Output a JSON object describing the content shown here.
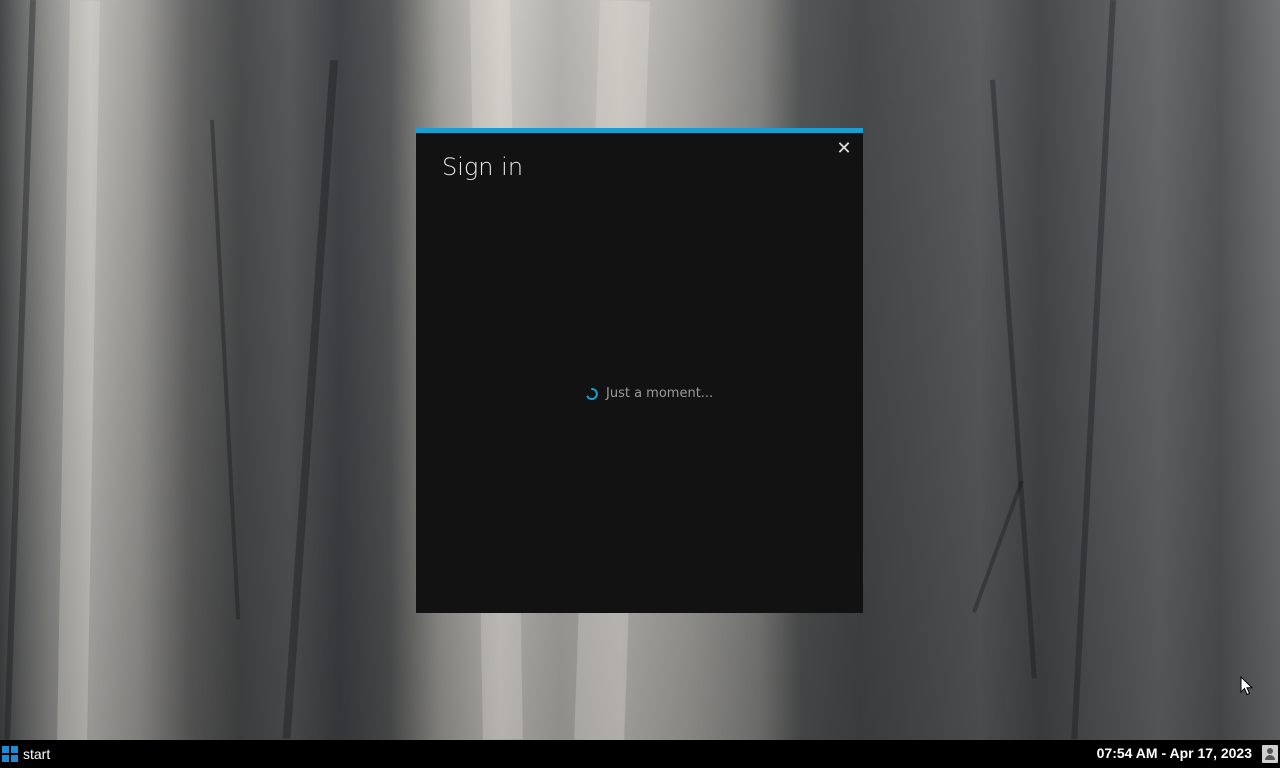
{
  "dialog": {
    "title": "Sign in",
    "close_glyph": "✕",
    "loading_text": "Just a moment...",
    "accent_color": "#1a9fd0"
  },
  "taskbar": {
    "start_label": "start",
    "clock": "07:54 AM - Apr 17, 2023"
  },
  "icons": {
    "start": "windows-logo-icon",
    "close": "close-icon",
    "spinner": "loading-spinner-icon",
    "tray": "user-icon",
    "cursor": "mouse-pointer-icon"
  }
}
